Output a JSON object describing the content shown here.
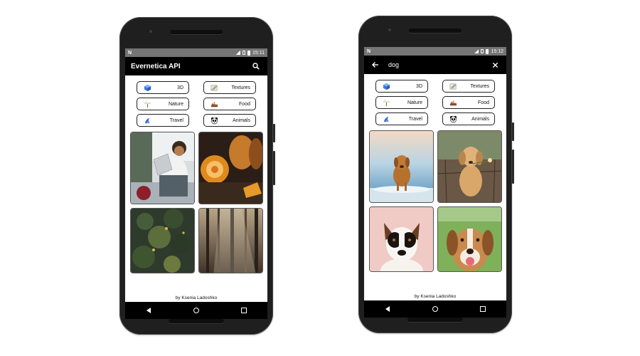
{
  "phones": [
    {
      "status_time": "15:11",
      "appbar_title": "Evernetica API",
      "credit": "by Ksenia Ladoshko"
    },
    {
      "status_time": "15:12",
      "search_query": "dog",
      "credit": "by Ksenia Ladoshko"
    }
  ],
  "categories": [
    {
      "label": "3D",
      "icon": "cube-icon"
    },
    {
      "label": "Textures",
      "icon": "texture-icon"
    },
    {
      "label": "Nature",
      "icon": "palm-tree-icon"
    },
    {
      "label": "Food",
      "icon": "cake-icon"
    },
    {
      "label": "Travel",
      "icon": "travel-icon"
    },
    {
      "label": "Animals",
      "icon": "panda-icon"
    }
  ],
  "colors": {
    "appbar": "#000000",
    "statusbar": "#757575",
    "chip_border": "#222222"
  }
}
